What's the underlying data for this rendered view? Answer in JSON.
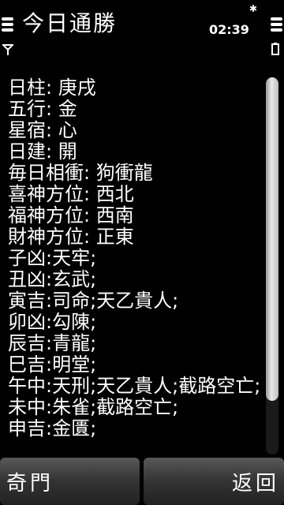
{
  "status_bar": {
    "title": "今日通勝",
    "time": "02:39",
    "icons": [
      "menu-icon",
      "bluetooth-icon",
      "signal-antenna-icon",
      "battery-icon"
    ]
  },
  "content": {
    "lines": [
      "日柱: 庚戌",
      "五行: 金",
      "星宿: 心",
      "日建: 開",
      "毎日相衝: 狗衝龍",
      "喜神方位: 西北",
      "福神方位: 西南",
      "財神方位: 正東",
      "子凶:天牢;",
      "丑凶:玄武;",
      "寅吉:司命;天乙貴人;",
      "卯凶:勾陳;",
      "辰吉:青龍;",
      "巳吉:明堂;",
      "午中:天刑;天乙貴人;截路空亡;",
      "未中:朱雀;截路空亡;",
      "申吉:金匱;"
    ]
  },
  "softkeys": {
    "left_label": "奇門",
    "right_label": "返回"
  },
  "colors": {
    "background": "#000000",
    "text": "#ffffff",
    "softkey_top": "#585858",
    "softkey_bottom": "#222222"
  }
}
